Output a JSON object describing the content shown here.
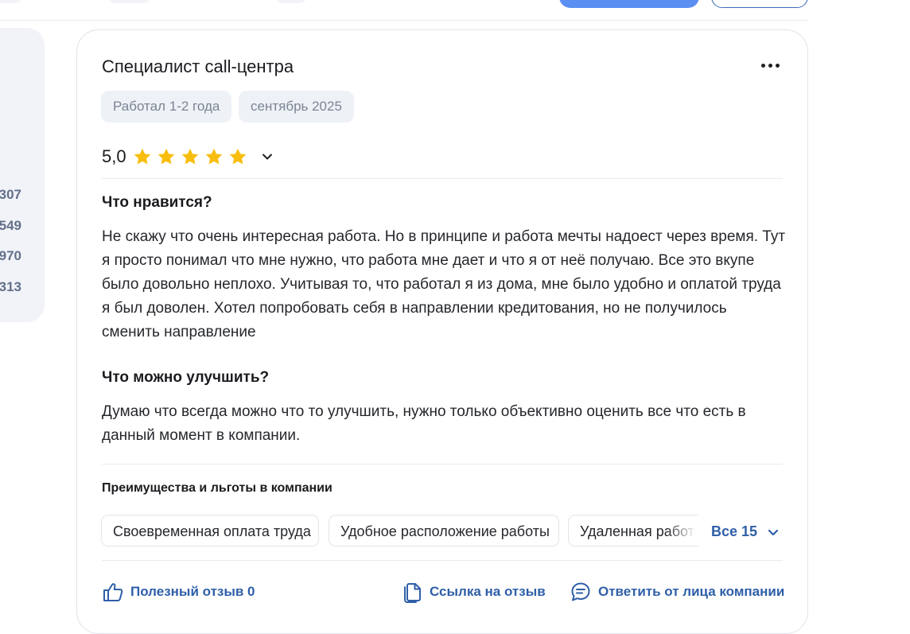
{
  "sidebar": {
    "stats": [
      "307",
      "549",
      "970",
      "313"
    ]
  },
  "review": {
    "title": "Специалист call-центра",
    "tags": [
      "Работал 1-2 года",
      "сентябрь 2025"
    ],
    "rating": {
      "value": "5,0",
      "stars": 5,
      "star_color": "#f8be0f"
    },
    "likes_heading": "Что нравится?",
    "likes_text": "Не скажу что очень интересная работа. Но в принципе и работа мечты надоест через время. Тут я просто понимал что мне нужно, что работа мне дает и что я от неё получаю. Все это вкупе было довольно неплохо. Учитывая то, что работал я из дома, мне было удобно и оплатой труда я был доволен. Хотел попробовать себя в направлении кредитования, но не получилось сменить направление",
    "improve_heading": "Что можно улучшить?",
    "improve_text": "Думаю что всегда можно что то улучшить, нужно только объективно оценить все что есть в данный момент в компании.",
    "benefits_heading": "Преимущества и льготы в компании",
    "benefits": [
      "Своевременная оплата труда",
      "Удобное расположение работы",
      "Удаленная работа"
    ],
    "benefits_all": "Все 15",
    "actions": {
      "helpful": "Полезный отзыв 0",
      "link": "Ссылка на отзыв",
      "reply": "Ответить от лица компании"
    }
  },
  "colors": {
    "accent": "#2f5fa8",
    "primary_button": "#5b8ff2"
  }
}
